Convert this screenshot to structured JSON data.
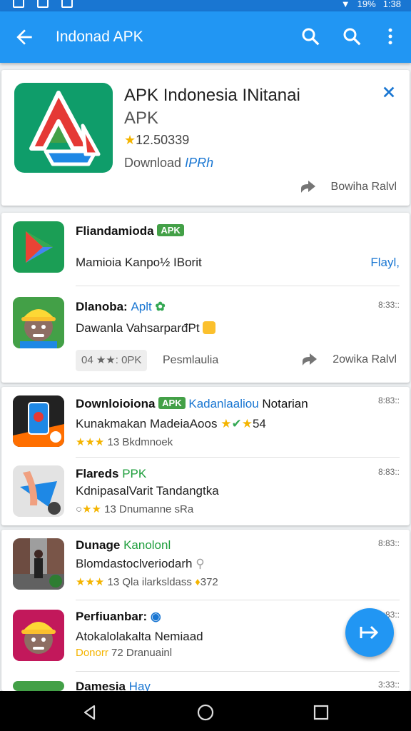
{
  "status_bar": {
    "battery": "19%",
    "time": "1:38"
  },
  "app_bar": {
    "title": "Indonad APK"
  },
  "featured": {
    "title": "APK Indonesia INitanai",
    "subtitle": "APK",
    "rating": "12.50339",
    "download_label": "Download",
    "download_accent": "IPRh",
    "action_label": "Bowiha Ralvl"
  },
  "list1": {
    "item1": {
      "name": "Fliandamioda",
      "badge": "APK",
      "desc": "Mamioia Kanpo½ IBorit",
      "right_label": "Flayl,"
    },
    "item2": {
      "name": "Dlanoba:",
      "name_accent": "Aplt",
      "time": "8:33::",
      "desc": "Dawanla VahsarparđPt",
      "chip": "04 ★★: 0PK",
      "chip_text": "Pesmlaulia",
      "action_label": "2owika Ralvl"
    }
  },
  "list2": {
    "item1": {
      "name": "Downloioiona",
      "badge": "APK",
      "name_accent": "Kadanlaaliou",
      "name_rest": "Notarian",
      "time": "8:83::",
      "desc": "Kunakmakan MadeiaAoos",
      "desc_tail": "54",
      "meta": "13 Bkdmnoek"
    },
    "item2": {
      "name": "Flareds",
      "name_accent": "PPK",
      "time": "8:83::",
      "desc": "KdnipasalVarit Tandangtka",
      "meta": "13 Dnumanne sRa"
    }
  },
  "list3": {
    "item1": {
      "name": "Dunage",
      "name_accent": "Kanolonl",
      "time": "8:83::",
      "desc": "Blomdastoclveriodarh",
      "meta": "13 Qla ilarksldass",
      "meta_tail": "372"
    },
    "item2": {
      "name": "Perfiuanbar:",
      "time": "8:83::",
      "desc": "Atokalolakalta Nemiaad",
      "meta_accent": "Donorr",
      "meta": "72 Dranuainl"
    },
    "item3": {
      "name": "Damesia",
      "name_accent": "Hay",
      "time": "3:33::"
    }
  },
  "colors": {
    "primary": "#2196f3",
    "primary_dark": "#1976d2",
    "badge_green": "#43a047",
    "star": "#f4b400"
  },
  "icons": [
    "back-arrow-icon",
    "search-icon",
    "more-vert-icon",
    "close-icon",
    "share-icon",
    "fab-arrow-icon",
    "nav-back-icon",
    "nav-home-icon",
    "nav-recents-icon"
  ]
}
